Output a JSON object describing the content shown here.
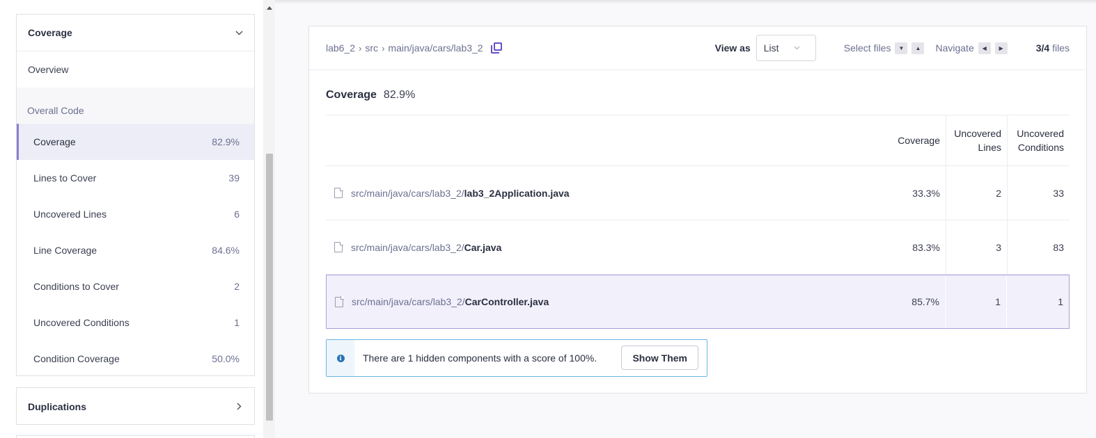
{
  "sidebar": {
    "coverage_panel": {
      "title": "Coverage",
      "overview": "Overview",
      "section_label": "Overall Code",
      "metrics": [
        {
          "name": "Coverage",
          "value": "82.9%",
          "active": true
        },
        {
          "name": "Lines to Cover",
          "value": "39"
        },
        {
          "name": "Uncovered Lines",
          "value": "6"
        },
        {
          "name": "Line Coverage",
          "value": "84.6%"
        },
        {
          "name": "Conditions to Cover",
          "value": "2"
        },
        {
          "name": "Uncovered Conditions",
          "value": "1"
        },
        {
          "name": "Condition Coverage",
          "value": "50.0%"
        }
      ]
    },
    "duplications_panel": {
      "title": "Duplications"
    }
  },
  "header": {
    "breadcrumbs": [
      "lab6_2",
      "src",
      "main/java/cars/lab3_2"
    ],
    "view_as_label": "View as",
    "view_as_value": "List",
    "select_files_label": "Select files",
    "navigate_label": "Navigate",
    "files_current": "3/4",
    "files_suffix": "files"
  },
  "summary": {
    "label": "Coverage",
    "value": "82.9%"
  },
  "table": {
    "headers": {
      "coverage": "Coverage",
      "uncovered_lines_1": "Uncovered",
      "uncovered_lines_2": "Lines",
      "uncovered_conditions_1": "Uncovered",
      "uncovered_conditions_2": "Conditions"
    },
    "rows": [
      {
        "path": "src/main/java/cars/lab3_2/",
        "file": "lab3_2Application.java",
        "coverage": "33.3%",
        "uncovered_lines": "2",
        "uncovered_conditions": "33"
      },
      {
        "path": "src/main/java/cars/lab3_2/",
        "file": "Car.java",
        "coverage": "83.3%",
        "uncovered_lines": "3",
        "uncovered_conditions": "83"
      },
      {
        "path": "src/main/java/cars/lab3_2/",
        "file": "CarController.java",
        "coverage": "85.7%",
        "uncovered_lines": "1",
        "uncovered_conditions": "1",
        "selected": true
      }
    ]
  },
  "notice": {
    "text": "There are 1 hidden components with a score of 100%.",
    "button": "Show Them"
  },
  "colors": {
    "accent": "#6a4fc8",
    "selected_row_bg": "#f1f0fb",
    "info": "#2b74b5"
  }
}
